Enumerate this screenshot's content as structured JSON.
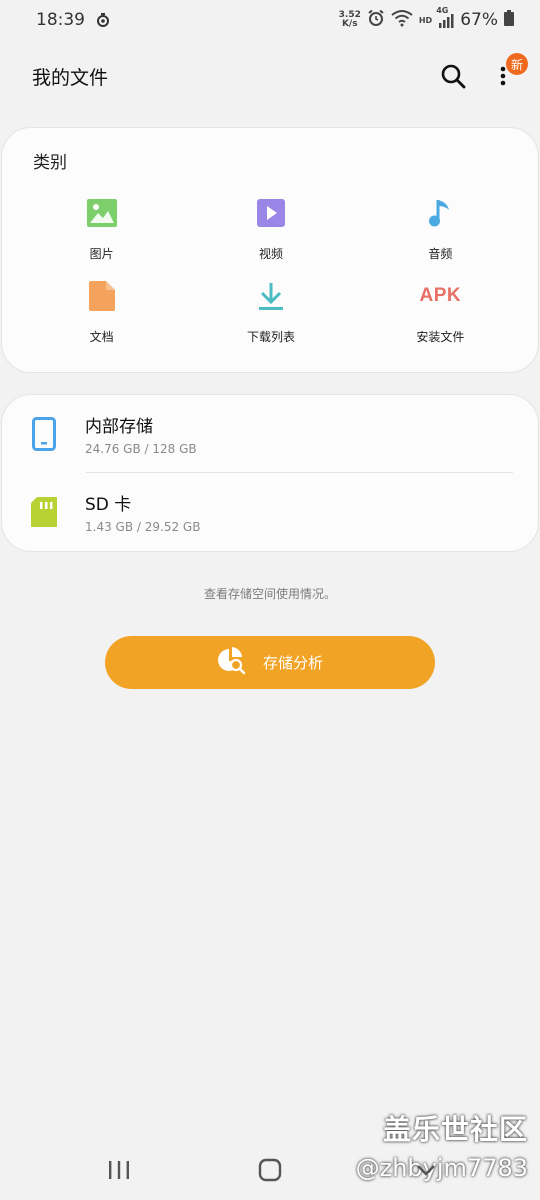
{
  "status_bar": {
    "time": "18:39",
    "net_speed_value": "3.52",
    "net_speed_unit": "K/s",
    "hd_label": "HD",
    "net_label": "4G",
    "battery": "67%",
    "icons": [
      "signal-ring-icon",
      "alarm-icon",
      "wifi-icon",
      "cellular-icon",
      "battery-icon"
    ]
  },
  "app_bar": {
    "title": "我的文件",
    "new_badge": "新"
  },
  "categories": {
    "title": "类别",
    "items": [
      {
        "label": "图片",
        "icon": "image-icon",
        "color": "#7ccf6b"
      },
      {
        "label": "视频",
        "icon": "video-icon",
        "color": "#9a86e6"
      },
      {
        "label": "音频",
        "icon": "music-icon",
        "color": "#4aa9e0"
      },
      {
        "label": "文档",
        "icon": "document-icon",
        "color": "#f5a25d"
      },
      {
        "label": "下载列表",
        "icon": "download-icon",
        "color": "#4bbcc1"
      },
      {
        "label": "安装文件",
        "icon": "apk-icon",
        "icon_text": "APK",
        "color": "#e87065"
      }
    ]
  },
  "storage": {
    "items": [
      {
        "name": "内部存储",
        "size": "24.76 GB / 128 GB",
        "icon": "phone-icon",
        "color": "#4aa3e8"
      },
      {
        "name": "SD 卡",
        "size": "1.43 GB / 29.52 GB",
        "icon": "sd-card-icon",
        "color": "#b8d234"
      }
    ]
  },
  "hint": "查看存储空间使用情况。",
  "analyze_button": {
    "label": "存储分析",
    "color": "#f1a326"
  },
  "watermark": {
    "title": "盖乐世社区",
    "handle": "@zhbyjm7783"
  },
  "nav_bar": {
    "buttons": [
      "recents-icon",
      "home-icon",
      "back-icon"
    ]
  }
}
